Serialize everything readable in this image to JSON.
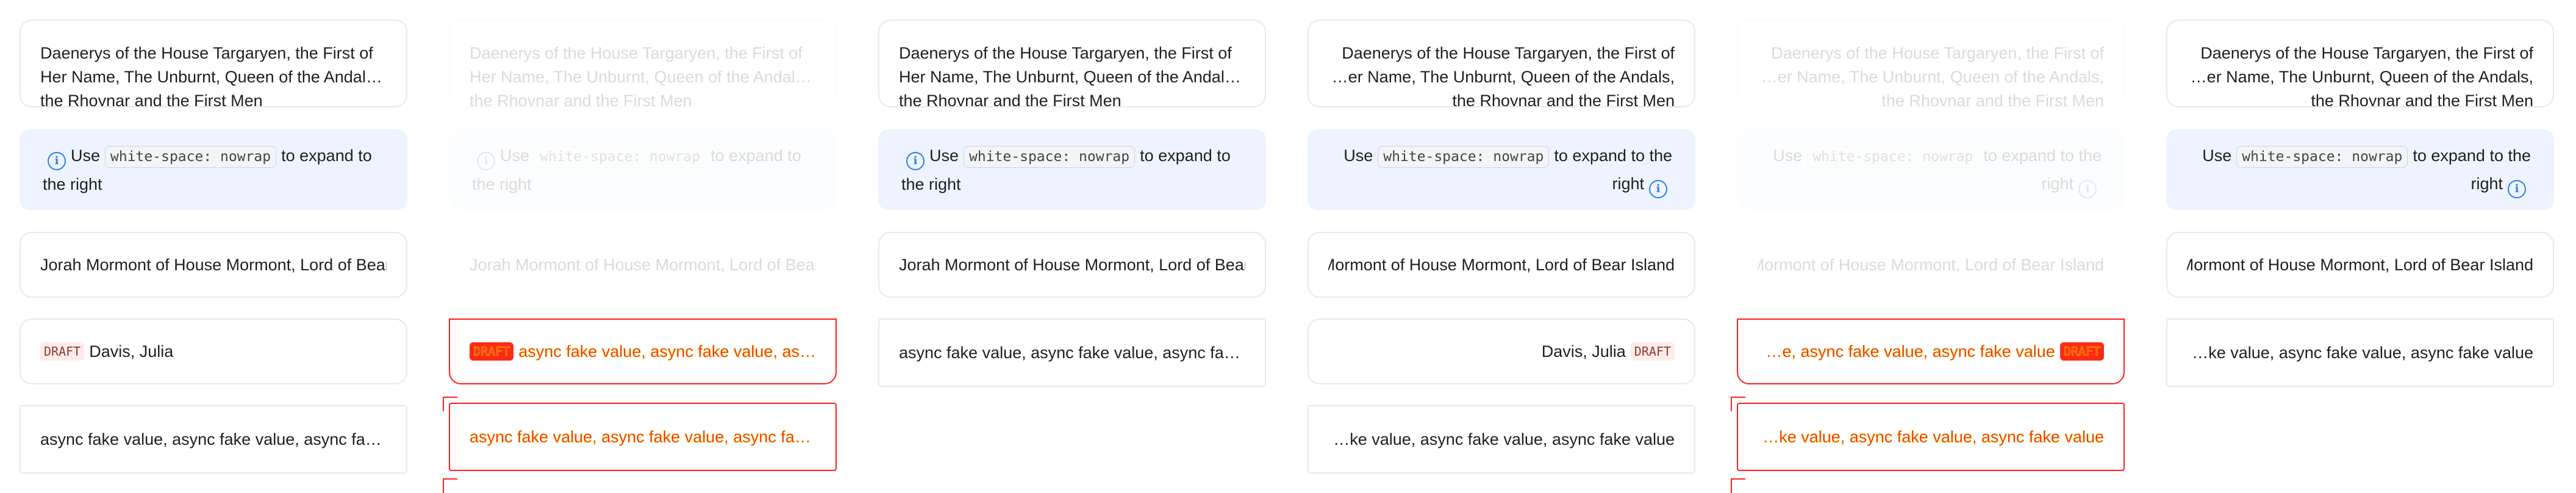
{
  "long_name": "Daenerys of the House Targaryen, the First of Her Name, The Unburnt, Queen of the Andals, the Rhoynar and the First Men",
  "info": {
    "prefix": "Use",
    "code": "white-space: nowrap",
    "suffix": "to expand to the right",
    "icon": "info-circle-icon"
  },
  "mormont": "Jorah Mormont of House Mormont, Lord of Bear Island",
  "person": {
    "draft_badge": "DRAFT",
    "name": "Davis, Julia"
  },
  "async_value": "async fake value, async fake value, async fake value",
  "colors": {
    "info_bg": "#edf4ff",
    "info_icon": "#2f7de1",
    "error_border": "#ff1b1b"
  }
}
